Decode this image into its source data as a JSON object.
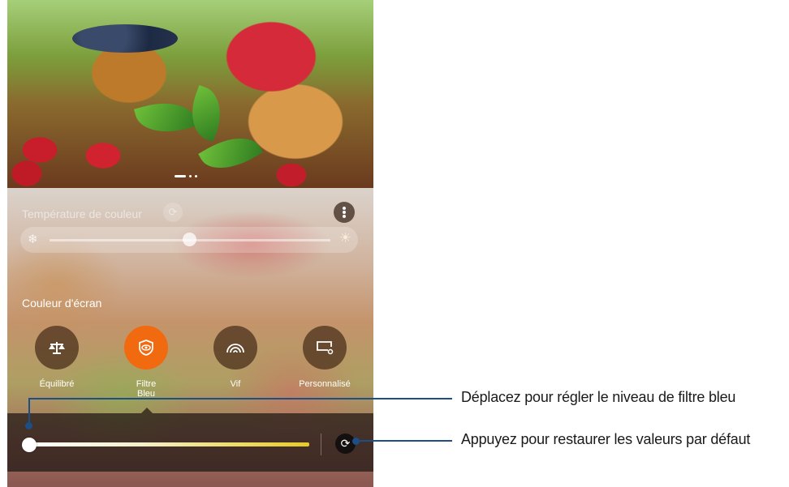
{
  "panel": {
    "color_temperature": {
      "title": "Température de couleur",
      "reset_icon": "refresh-icon",
      "more_icon": "more-vert-icon",
      "cold_icon": "snowflake-icon",
      "warm_icon": "sun-icon"
    },
    "screen_color": {
      "title": "Couleur d'écran",
      "modes": [
        {
          "label": "Équilibré",
          "icon": "balance-icon",
          "active": false
        },
        {
          "label": "Filtre Bleu",
          "icon": "eye-shield-icon",
          "active": true
        },
        {
          "label": "Vif",
          "icon": "vivid-icon",
          "active": false
        },
        {
          "label": "Personnalisé",
          "icon": "custom-screen-icon",
          "active": false
        }
      ]
    },
    "blue_filter": {
      "reset_icon": "refresh-icon",
      "level": 0
    }
  },
  "callouts": {
    "slider": "Déplacez pour régler le niveau de filtre bleu",
    "reset": "Appuyez pour restaurer les valeurs par défaut"
  },
  "colors": {
    "accent": "#f26a0f",
    "callout": "#1b4f86"
  }
}
